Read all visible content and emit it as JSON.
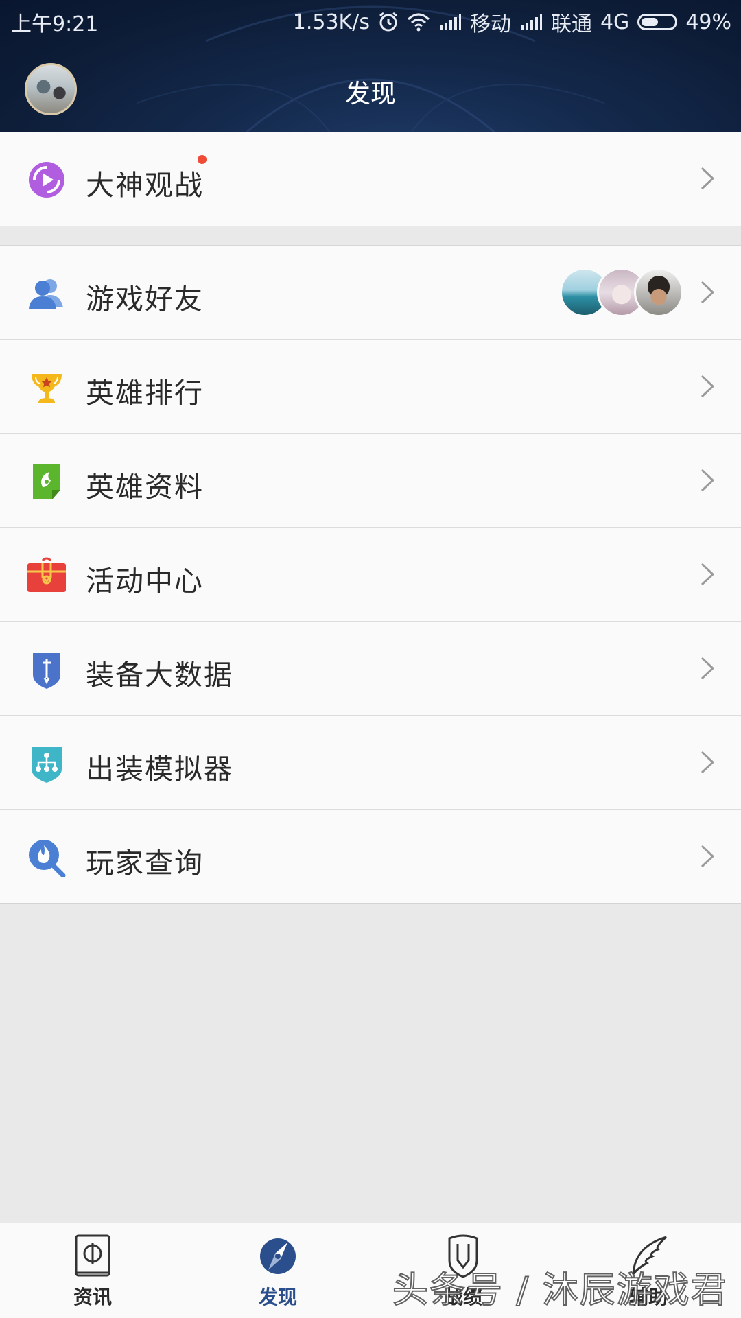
{
  "status_bar": {
    "time": "上午9:21",
    "speed": "1.53K/s",
    "carrier1": "移动",
    "carrier2": "联通",
    "network": "4G",
    "battery": "49%",
    "icons": [
      "alarm-icon",
      "wifi-icon",
      "signal-icon",
      "signal-icon",
      "battery-icon"
    ]
  },
  "header": {
    "title": "发现"
  },
  "list_top": [
    {
      "label": "大神观战",
      "icon": "play-circle-icon",
      "icon_color": "#b05de0",
      "has_dot": true
    }
  ],
  "list_main": [
    {
      "label": "游戏好友",
      "icon": "friends-icon",
      "icon_color": "#4a7fd3",
      "friend_avatars": 3
    },
    {
      "label": "英雄排行",
      "icon": "trophy-icon",
      "icon_color": "#f5b81c"
    },
    {
      "label": "英雄资料",
      "icon": "hero-file-icon",
      "icon_color": "#5bb52d"
    },
    {
      "label": "活动中心",
      "icon": "gift-box-icon",
      "icon_color": "#e8413c"
    },
    {
      "label": "装备大数据",
      "icon": "shield-sword-icon",
      "icon_color": "#4a73c9"
    },
    {
      "label": "出装模拟器",
      "icon": "tree-shield-icon",
      "icon_color": "#3fb6c8"
    },
    {
      "label": "玩家查询",
      "icon": "search-flame-icon",
      "icon_color": "#4a7fd3"
    }
  ],
  "tabbar": {
    "items": [
      {
        "label": "资讯",
        "icon": "news-book-icon",
        "active": false
      },
      {
        "label": "发现",
        "icon": "compass-icon",
        "active": true
      },
      {
        "label": "战绩",
        "icon": "helmet-icon",
        "active": false
      },
      {
        "label": "辅助",
        "icon": "wing-icon",
        "active": false
      }
    ],
    "active_color": "#2b4f8c"
  },
  "watermark": "头条号 / 沐辰游戏君"
}
